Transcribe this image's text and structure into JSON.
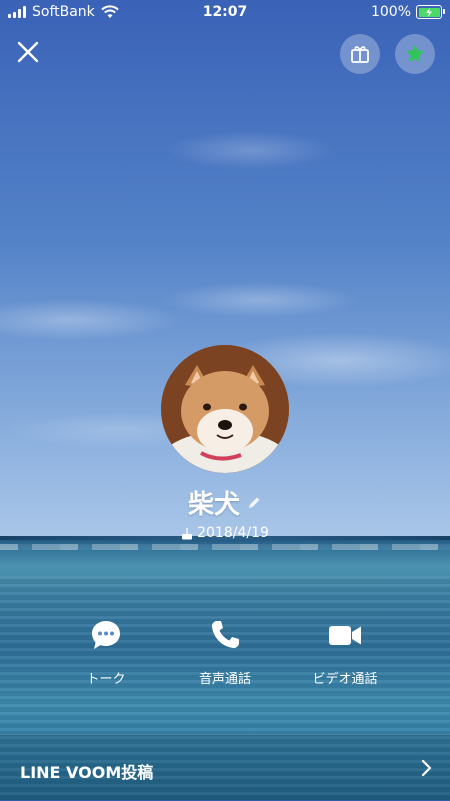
{
  "status_bar": {
    "carrier": "SoftBank",
    "time": "12:07",
    "battery": "100%"
  },
  "profile": {
    "name": "柴犬",
    "birthday": "2018/4/19"
  },
  "actions": [
    {
      "label": "トーク"
    },
    {
      "label": "音声通話"
    },
    {
      "label": "ビデオ通話"
    }
  ],
  "bottom_bar": {
    "label": "LINE VOOM投稿"
  },
  "colors": {
    "favorite_star": "#2fc55a",
    "battery_fill": "#4cd964"
  }
}
